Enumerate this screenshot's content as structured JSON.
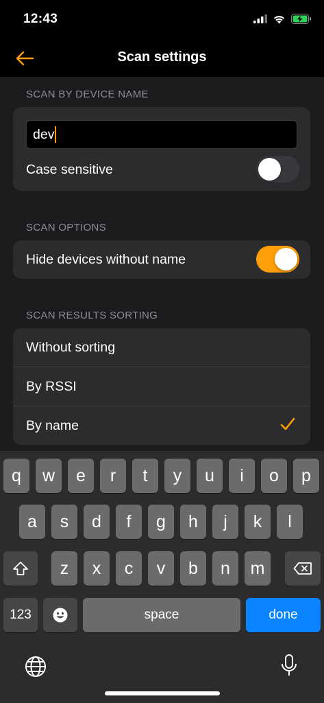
{
  "status": {
    "time": "12:43"
  },
  "nav": {
    "title": "Scan settings"
  },
  "sections": {
    "device_name": {
      "header": "Scan by device name",
      "input_value": "dev",
      "case_sensitive_label": "Case sensitive",
      "case_sensitive_on": false
    },
    "scan_options": {
      "header": "Scan options",
      "hide_unnamed_label": "Hide devices without name",
      "hide_unnamed_on": true
    },
    "sorting": {
      "header": "Scan results sorting",
      "options": [
        "Without sorting",
        "By RSSI",
        "By name"
      ],
      "selected": "By name"
    }
  },
  "keyboard": {
    "row1": [
      "q",
      "w",
      "e",
      "r",
      "t",
      "y",
      "u",
      "i",
      "o",
      "p"
    ],
    "row2": [
      "a",
      "s",
      "d",
      "f",
      "g",
      "h",
      "j",
      "k",
      "l"
    ],
    "row3": [
      "z",
      "x",
      "c",
      "v",
      "b",
      "n",
      "m"
    ],
    "numbers_label": "123",
    "space_label": "space",
    "done_label": "done"
  },
  "colors": {
    "accent": "#ff9f0a",
    "done_key": "#0a84ff",
    "card": "#2c2c2e"
  }
}
